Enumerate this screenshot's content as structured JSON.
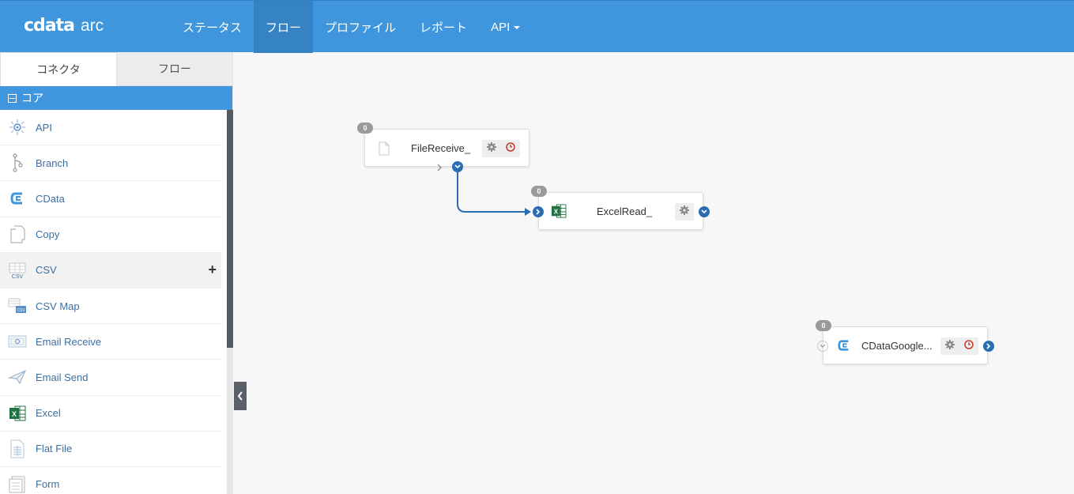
{
  "app": {
    "brand": "cdata",
    "product": "arc"
  },
  "nav": [
    {
      "label": "ステータス",
      "active": false
    },
    {
      "label": "フロー",
      "active": true
    },
    {
      "label": "プロファイル",
      "active": false
    },
    {
      "label": "レポート",
      "active": false
    },
    {
      "label": "API",
      "active": false,
      "dropdown": true
    }
  ],
  "sidebar": {
    "tabs": [
      {
        "label": "コネクタ",
        "active": true
      },
      {
        "label": "フロー",
        "active": false
      }
    ],
    "section": "コア",
    "items": [
      {
        "label": "API",
        "icon": "api-icon"
      },
      {
        "label": "Branch",
        "icon": "branch-icon"
      },
      {
        "label": "CData",
        "icon": "cdata-icon"
      },
      {
        "label": "Copy",
        "icon": "copy-icon"
      },
      {
        "label": "CSV",
        "icon": "csv-icon",
        "hover": true
      },
      {
        "label": "CSV Map",
        "icon": "csv-map-icon"
      },
      {
        "label": "Email Receive",
        "icon": "email-receive-icon"
      },
      {
        "label": "Email Send",
        "icon": "email-send-icon"
      },
      {
        "label": "Excel",
        "icon": "excel-icon"
      },
      {
        "label": "Flat File",
        "icon": "flat-file-icon"
      },
      {
        "label": "Form",
        "icon": "form-icon"
      }
    ],
    "add_symbol": "+"
  },
  "flow": {
    "nodes": [
      {
        "title": "FileReceive_",
        "count": "0",
        "icon": "file-icon"
      },
      {
        "title": "ExcelRead_",
        "count": "0",
        "icon": "excel-icon"
      },
      {
        "title": "CDataGoogle...",
        "count": "0",
        "icon": "cdata-icon"
      }
    ]
  },
  "colors": {
    "accent": "#3f96dc",
    "port": "#2b6db3",
    "error": "#c0392b"
  }
}
